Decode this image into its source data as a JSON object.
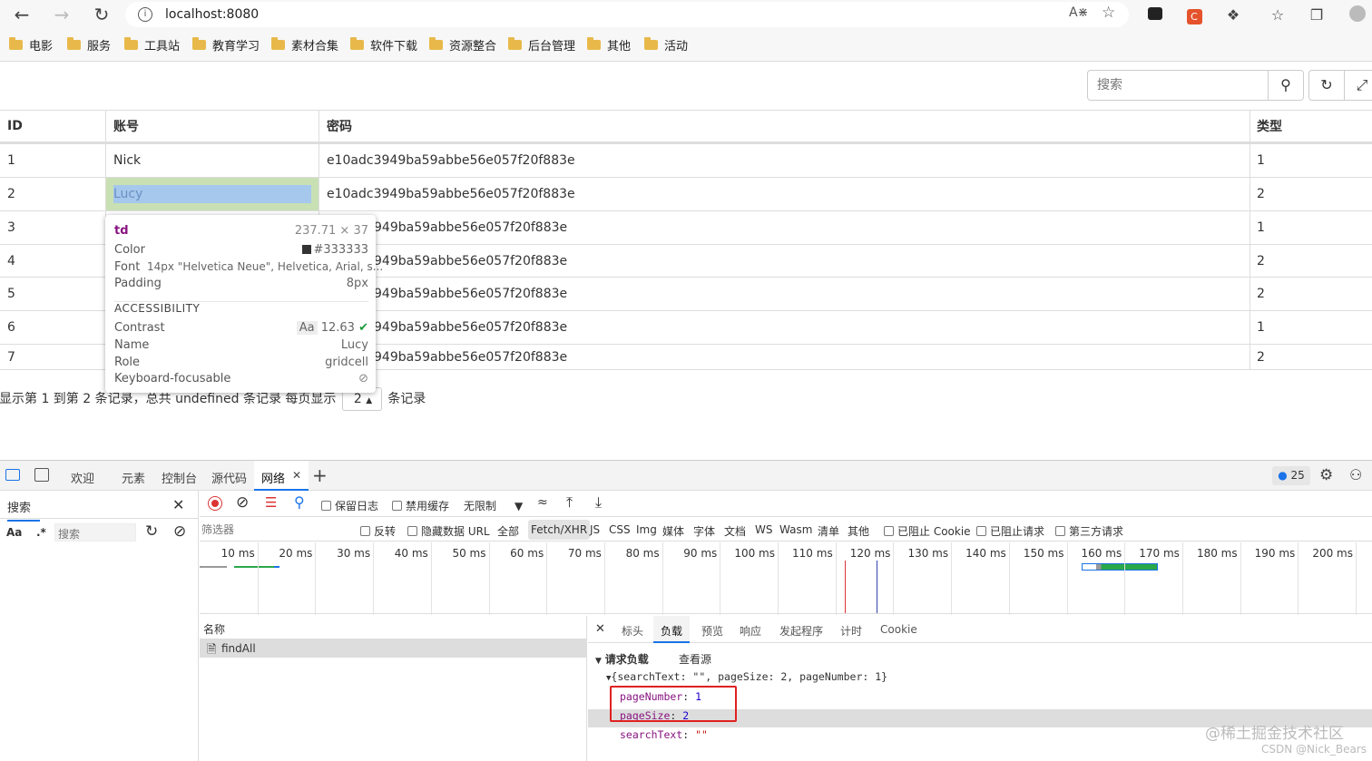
{
  "browser": {
    "url": "localhost:8080",
    "bookmarks": [
      "电影",
      "服务",
      "工具站",
      "教育学习",
      "素材合集",
      "软件下载",
      "资源整合",
      "后台管理",
      "其他",
      "活动"
    ]
  },
  "toolbar": {
    "search_placeholder": "搜索"
  },
  "table": {
    "headers": [
      "ID",
      "账号",
      "密码",
      "类型"
    ],
    "rows": [
      {
        "id": "1",
        "account": "Nick",
        "password": "e10adc3949ba59abbe56e057f20f883e",
        "type": "1"
      },
      {
        "id": "2",
        "account": "Lucy",
        "password": "e10adc3949ba59abbe56e057f20f883e",
        "type": "2"
      },
      {
        "id": "3",
        "account": "",
        "password": "949ba59abbe56e057f20f883e",
        "type": "1"
      },
      {
        "id": "4",
        "account": "",
        "password": "949ba59abbe56e057f20f883e",
        "type": "2"
      },
      {
        "id": "5",
        "account": "",
        "password": "949ba59abbe56e057f20f883e",
        "type": "2"
      },
      {
        "id": "6",
        "account": "",
        "password": "949ba59abbe56e057f20f883e",
        "type": "1"
      },
      {
        "id": "7",
        "account": "",
        "password": "949ba59abbe56e057f20f883e",
        "type": "2"
      }
    ],
    "pager_text": "显示第 1 到第 2 条记录，总共 undefined 条记录 每页显示",
    "page_size": "2",
    "pager_suffix": "条记录"
  },
  "inspect_tooltip": {
    "tag": "td",
    "size": "237.71 × 37",
    "color_label": "Color",
    "color_value": "#333333",
    "font_label": "Font",
    "font_value": "14px \"Helvetica Neue\", Helvetica, Arial, s...",
    "padding_label": "Padding",
    "padding_value": "8px",
    "accessibility_title": "ACCESSIBILITY",
    "contrast_label": "Contrast",
    "contrast_aa": "Aa",
    "contrast_value": "12.63",
    "name_label": "Name",
    "name_value": "Lucy",
    "role_label": "Role",
    "role_value": "gridcell",
    "focusable_label": "Keyboard-focusable"
  },
  "devtools": {
    "tabs": [
      "欢迎",
      "元素",
      "控制台",
      "源代码",
      "网络"
    ],
    "issues_count": "25",
    "search_panel_title": "搜索",
    "search_aa": "Aa",
    "search_regex": ".*",
    "search_placeholder": "搜索",
    "preserve_log": "保留日志",
    "disable_cache": "禁用缓存",
    "throttle": "无限制",
    "filter_placeholder": "筛选器",
    "filter_options": [
      "反转",
      "隐藏数据 URL",
      "全部"
    ],
    "type_filters": [
      "Fetch/XHR",
      "JS",
      "CSS",
      "Img",
      "媒体",
      "字体",
      "文档",
      "WS",
      "Wasm",
      "清单",
      "其他"
    ],
    "blocked_cookies": "已阻止 Cookie",
    "blocked_requests": "已阻止请求",
    "third_party": "第三方请求",
    "timeline_ticks": [
      "10 ms",
      "20 ms",
      "30 ms",
      "40 ms",
      "50 ms",
      "60 ms",
      "70 ms",
      "80 ms",
      "90 ms",
      "100 ms",
      "110 ms",
      "120 ms",
      "130 ms",
      "140 ms",
      "150 ms",
      "160 ms",
      "170 ms",
      "180 ms",
      "190 ms",
      "200 ms"
    ],
    "name_column": "名称",
    "request_name": "findAll",
    "detail_tabs": [
      "标头",
      "负载",
      "预览",
      "响应",
      "发起程序",
      "计时",
      "Cookie"
    ],
    "payload_title": "请求负载",
    "view_source": "查看源",
    "payload_summary": "{searchText: \"\", pageSize: 2, pageNumber: 1}",
    "payload_fields": [
      {
        "key": "pageNumber",
        "value": "1"
      },
      {
        "key": "pageSize",
        "value": "2"
      },
      {
        "key": "searchText",
        "value": "\"\""
      }
    ]
  },
  "watermark": {
    "line1": "@稀土掘金技术社区",
    "line2": "CSDN @Nick_Bears"
  },
  "colors": {
    "highlight_cell": "#c8e0b4",
    "selected_text": "#a6c8ec",
    "devtools_accent": "#1a73e8",
    "payload_box": "#e02020"
  }
}
